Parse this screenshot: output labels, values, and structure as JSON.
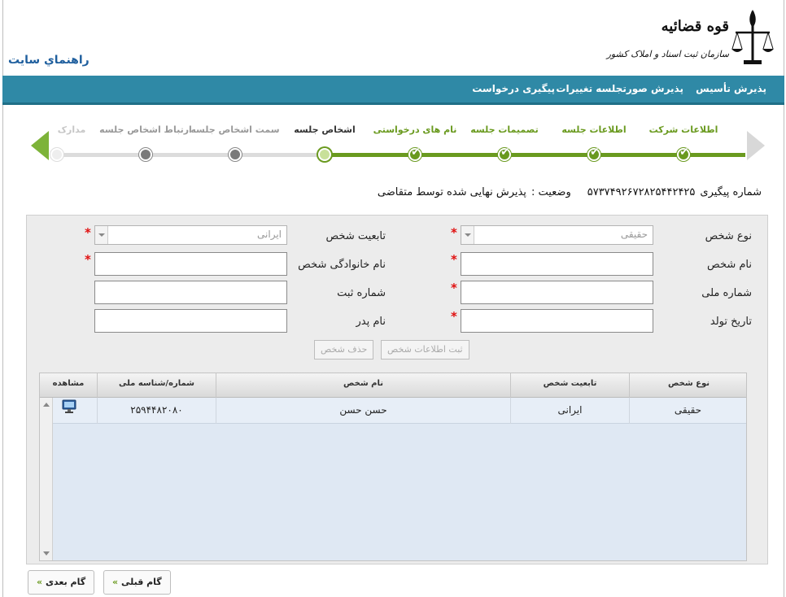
{
  "header": {
    "help_link": "راهنماي سایت",
    "logo_title": "قوه قضائیه",
    "logo_subtitle": "سازمان ثبت اسناد و املاک کشور"
  },
  "nav": {
    "items": [
      "پذیرش تأسیس",
      "پذیرش صورتجلسه تغییرات",
      "پیگیری درخواست"
    ]
  },
  "steps": [
    {
      "label": "اطلاعات شرکت",
      "state": "done"
    },
    {
      "label": "اطلاعات جلسه",
      "state": "done"
    },
    {
      "label": "تصمیمات جلسه",
      "state": "done"
    },
    {
      "label": "نام های درخواستی",
      "state": "done"
    },
    {
      "label": "اشخاص جلسه",
      "state": "current"
    },
    {
      "label": "سمت اشخاص جلسه",
      "state": "todo"
    },
    {
      "label": "ارتباط اشخاص جلسه",
      "state": "todo"
    },
    {
      "label": "مدارک",
      "state": "faint"
    }
  ],
  "tracking": {
    "label": "شماره پیگیری",
    "number": "۵۷۳۷۴۹۲۶۷۲۸۲۵۴۴۲۴۲۵",
    "status_label": "وضعیت :",
    "status_value": "پذیرش نهایی شده توسط متقاضی"
  },
  "form": {
    "person_type_label": "نوع شخص",
    "person_type_value": "حقیقی",
    "nationality_label": "تابعیت شخص",
    "nationality_value": "ایرانی",
    "first_name_label": "نام شخص",
    "first_name_value": "",
    "last_name_label": "نام خانوادگی شخص",
    "last_name_value": "",
    "national_id_label": "شماره ملی",
    "national_id_value": "",
    "reg_number_label": "شماره ثبت",
    "reg_number_value": "",
    "birth_date_label": "تاریخ تولد",
    "birth_date_value": "",
    "father_name_label": "نام پدر",
    "father_name_value": "",
    "required_mark": "*",
    "save_button": "ثبت اطلاعات شخص",
    "delete_button": "حذف شخص"
  },
  "grid": {
    "columns": [
      "نوع شخص",
      "تابعیت شخص",
      "نام شخص",
      "شماره/شناسه ملی",
      "مشاهده"
    ],
    "rows": [
      {
        "type": "حقیقی",
        "nationality": "ایرانی",
        "name": "حسن حسن",
        "national_id": "۲۵۹۴۴۸۲۰۸۰"
      }
    ]
  },
  "buttons": {
    "prev": "گام قبلی",
    "next": "گام بعدی",
    "chevron": "«"
  },
  "colors": {
    "navbar": "#2f89a6",
    "step_done": "#6a9a1f",
    "required": "#e01010",
    "help_link": "#1f5f9e"
  }
}
